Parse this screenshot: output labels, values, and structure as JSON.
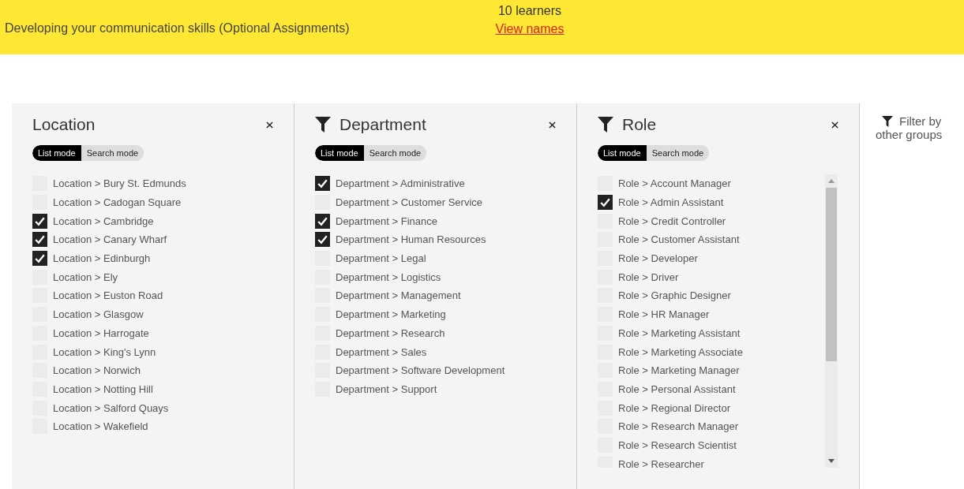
{
  "header": {
    "title": "Developing your communication skills (Optional Assignments)",
    "learner_count": "10 learners",
    "view_link": "View names"
  },
  "panels": [
    {
      "title": "Location",
      "filter_icon": false,
      "modes": [
        {
          "label": "List mode",
          "selected": true
        },
        {
          "label": "Search mode",
          "selected": false
        }
      ],
      "scrollable": false,
      "items": [
        {
          "label": "Location > Bury St. Edmunds",
          "checked": false
        },
        {
          "label": "Location > Cadogan Square",
          "checked": false
        },
        {
          "label": "Location > Cambridge",
          "checked": true
        },
        {
          "label": "Location > Canary Wharf",
          "checked": true
        },
        {
          "label": "Location > Edinburgh",
          "checked": true
        },
        {
          "label": "Location > Ely",
          "checked": false
        },
        {
          "label": "Location > Euston Road",
          "checked": false
        },
        {
          "label": "Location > Glasgow",
          "checked": false
        },
        {
          "label": "Location > Harrogate",
          "checked": false
        },
        {
          "label": "Location > King's Lynn",
          "checked": false
        },
        {
          "label": "Location > Norwich",
          "checked": false
        },
        {
          "label": "Location > Notting Hill",
          "checked": false
        },
        {
          "label": "Location > Salford Quays",
          "checked": false
        },
        {
          "label": "Location > Wakefield",
          "checked": false
        }
      ]
    },
    {
      "title": "Department",
      "filter_icon": true,
      "modes": [
        {
          "label": "List mode",
          "selected": true
        },
        {
          "label": "Search mode",
          "selected": false
        }
      ],
      "scrollable": false,
      "items": [
        {
          "label": "Department > Administrative",
          "checked": true
        },
        {
          "label": "Department > Customer Service",
          "checked": false
        },
        {
          "label": "Department > Finance",
          "checked": true
        },
        {
          "label": "Department > Human Resources",
          "checked": true
        },
        {
          "label": "Department > Legal",
          "checked": false
        },
        {
          "label": "Department > Logistics",
          "checked": false
        },
        {
          "label": "Department > Management",
          "checked": false
        },
        {
          "label": "Department > Marketing",
          "checked": false
        },
        {
          "label": "Department > Research",
          "checked": false
        },
        {
          "label": "Department > Sales",
          "checked": false
        },
        {
          "label": "Department > Software Development",
          "checked": false
        },
        {
          "label": "Department > Support",
          "checked": false
        }
      ]
    },
    {
      "title": "Role",
      "filter_icon": true,
      "modes": [
        {
          "label": "List mode",
          "selected": true
        },
        {
          "label": "Search mode",
          "selected": false
        }
      ],
      "scrollable": true,
      "items": [
        {
          "label": "Role > Account Manager",
          "checked": false
        },
        {
          "label": "Role > Admin Assistant",
          "checked": true
        },
        {
          "label": "Role > Credit Controller",
          "checked": false
        },
        {
          "label": "Role > Customer Assistant",
          "checked": false
        },
        {
          "label": "Role > Developer",
          "checked": false
        },
        {
          "label": "Role > Driver",
          "checked": false
        },
        {
          "label": "Role > Graphic Designer",
          "checked": false
        },
        {
          "label": "Role > HR Manager",
          "checked": false
        },
        {
          "label": "Role > Marketing Assistant",
          "checked": false
        },
        {
          "label": "Role > Marketing Associate",
          "checked": false
        },
        {
          "label": "Role > Marketing Manager",
          "checked": false
        },
        {
          "label": "Role > Personal Assistant",
          "checked": false
        },
        {
          "label": "Role > Regional Director",
          "checked": false
        },
        {
          "label": "Role > Research Manager",
          "checked": false
        },
        {
          "label": "Role > Research Scientist",
          "checked": false
        },
        {
          "label": "Role > Researcher",
          "checked": false
        }
      ]
    }
  ],
  "other_groups": {
    "label": "Filter by other groups"
  }
}
